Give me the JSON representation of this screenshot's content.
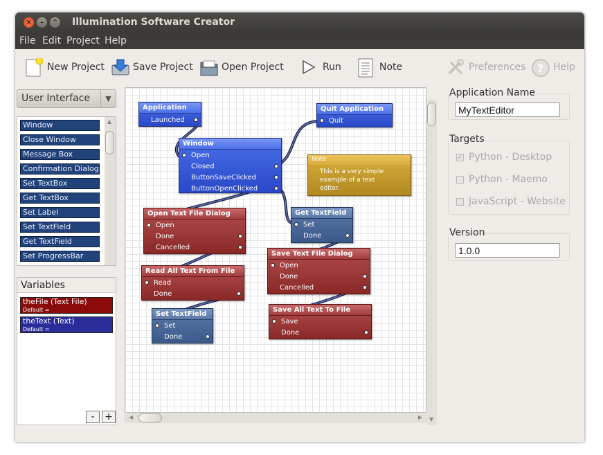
{
  "window": {
    "title": "Illumination Software Creator"
  },
  "menu": [
    "File",
    "Edit",
    "Project",
    "Help"
  ],
  "toolbar": {
    "new_project": "New Project",
    "save_project": "Save Project",
    "open_project": "Open Project",
    "run": "Run",
    "note": "Note",
    "preferences": "Preferences",
    "help": "Help"
  },
  "category": {
    "selected": "User Interface"
  },
  "blocks": [
    "Window",
    "Close Window",
    "Message Box",
    "Confirmation Dialog",
    "Set TextBox",
    "Get TextBox",
    "Set Label",
    "Set TextField",
    "Get TextField",
    "Set ProgressBar"
  ],
  "variables": {
    "heading": "Variables",
    "items": [
      {
        "name": "theFile (Text File)",
        "default": "Default =",
        "color": "#8b0a0a"
      },
      {
        "name": "theText (Text)",
        "default": "Default =",
        "color": "#2a2c9a"
      }
    ],
    "remove": "-",
    "add": "+"
  },
  "canvas": {
    "application": {
      "title": "Application",
      "ports": [
        "Launched"
      ]
    },
    "window": {
      "title": "Window",
      "ports": [
        "Open",
        "Closed",
        "ButtonSaveClicked",
        "ButtonOpenClicked"
      ]
    },
    "quit": {
      "title": "Quit Application",
      "ports": [
        "Quit"
      ]
    },
    "note": {
      "title": "Note",
      "text": "This is a very simple\nexample of a text\neditor."
    },
    "get_textfield": {
      "title": "Get TextField",
      "ports": [
        "Set",
        "Done"
      ]
    },
    "open_dialog": {
      "title": "Open Text File Dialog",
      "ports": [
        "Open",
        "Done",
        "Cancelled"
      ]
    },
    "read_all": {
      "title": "Read All Text From File",
      "ports": [
        "Read",
        "Done"
      ]
    },
    "set_textfield": {
      "title": "Set TextField",
      "ports": [
        "Set",
        "Done"
      ]
    },
    "save_dialog": {
      "title": "Save Text File Dialog",
      "ports": [
        "Open",
        "Done",
        "Cancelled"
      ]
    },
    "save_all": {
      "title": "Save All Text To File",
      "ports": [
        "Save",
        "Done"
      ]
    }
  },
  "properties": {
    "app_name_label": "Application Name",
    "app_name_value": "MyTextEditor",
    "targets_label": "Targets",
    "targets": [
      {
        "label": "Python - Desktop",
        "checked": true
      },
      {
        "label": "Python - Maemo",
        "checked": false
      },
      {
        "label": "JavaScript - Website",
        "checked": false
      }
    ],
    "version_label": "Version",
    "version_value": "1.0.0"
  }
}
